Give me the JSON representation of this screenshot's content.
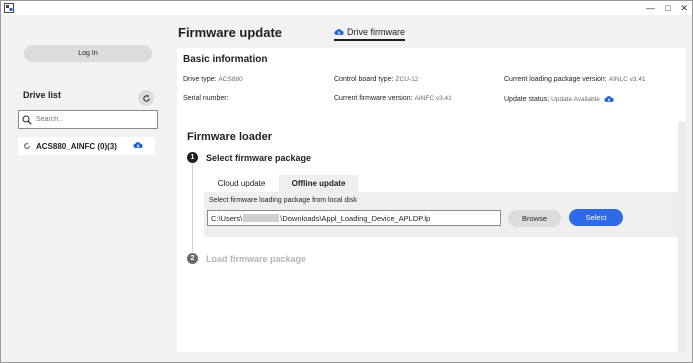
{
  "colors": {
    "accent": "#2f6ae6",
    "cloud_icon": "#1f5fd6"
  },
  "sidebar": {
    "login_label": "Log In",
    "drive_list_title": "Drive list",
    "search": {
      "placeholder": "Search.."
    },
    "drives": [
      {
        "label": "ACS880_AINFC (0)(3)",
        "icon": "cloud-icon"
      }
    ]
  },
  "main": {
    "title": "Firmware update",
    "tab_label": "Drive firmware",
    "basic": {
      "title": "Basic information",
      "drive_type": {
        "label": "Drive type:",
        "value": "ACS880"
      },
      "serial_number": {
        "label": "Serial number:",
        "value": ""
      },
      "control_board_type": {
        "label": "Control board type:",
        "value": "ZCU-12"
      },
      "current_firmware_version": {
        "label": "Current firmware version:",
        "value": "AINFC v3.41"
      },
      "current_loading_package_version": {
        "label": "Current loading package version:",
        "value": "AINLC v3.41"
      },
      "update_status": {
        "label": "Update status:",
        "value": "Update Available"
      }
    },
    "loader": {
      "title": "Firmware loader",
      "step1": {
        "num": "1",
        "label": "Select firmware package"
      },
      "step2": {
        "num": "2",
        "label": "Load firmware package"
      },
      "tabs": {
        "cloud": "Cloud update",
        "offline": "Offline update"
      },
      "panel_label": "Select firmware loading package from local disk",
      "path_prefix": "C:\\Users\\",
      "path_suffix": "\\Downloads\\Appl_Loading_Device_APLDP.lp",
      "browse_label": "Browse",
      "select_label": "Select"
    }
  }
}
